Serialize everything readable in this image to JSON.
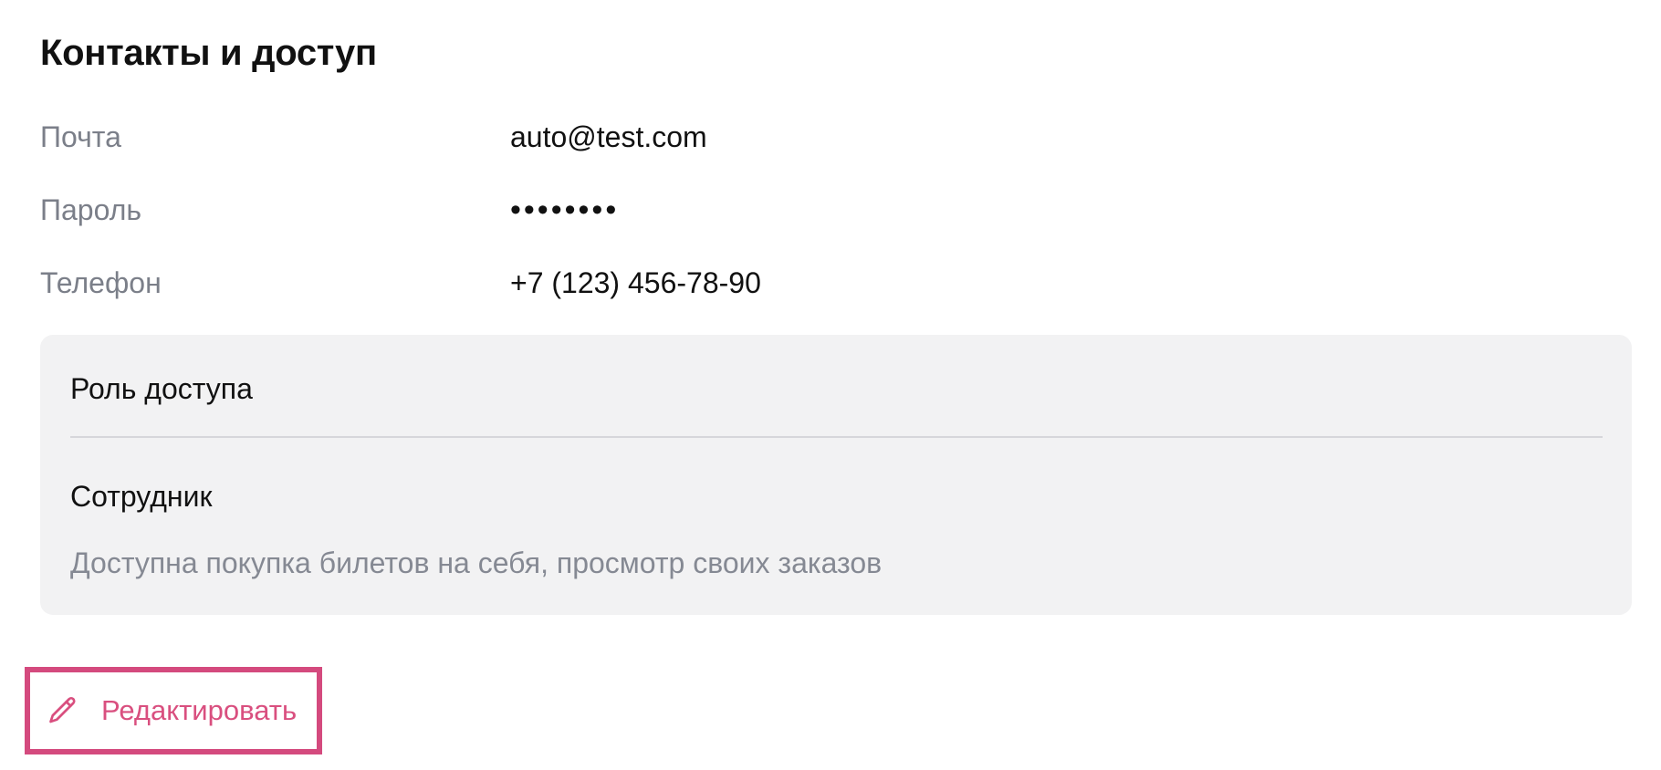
{
  "section": {
    "title": "Контакты и доступ"
  },
  "fields": {
    "email": {
      "label": "Почта",
      "value": "auto@test.com"
    },
    "password": {
      "label": "Пароль",
      "value": "••••••••"
    },
    "phone": {
      "label": "Телефон",
      "value": "+7 (123) 456-78-90"
    }
  },
  "role_card": {
    "heading": "Роль доступа",
    "role_name": "Сотрудник",
    "description": "Доступна покупка билетов на себя, просмотр своих заказов"
  },
  "actions": {
    "edit_label": "Редактировать",
    "edit_icon": "pencil-icon"
  },
  "colors": {
    "accent": "#d94f7f",
    "highlight_border": "#d44a7e",
    "muted_text": "#7b7f89",
    "card_background": "#f2f2f3"
  }
}
